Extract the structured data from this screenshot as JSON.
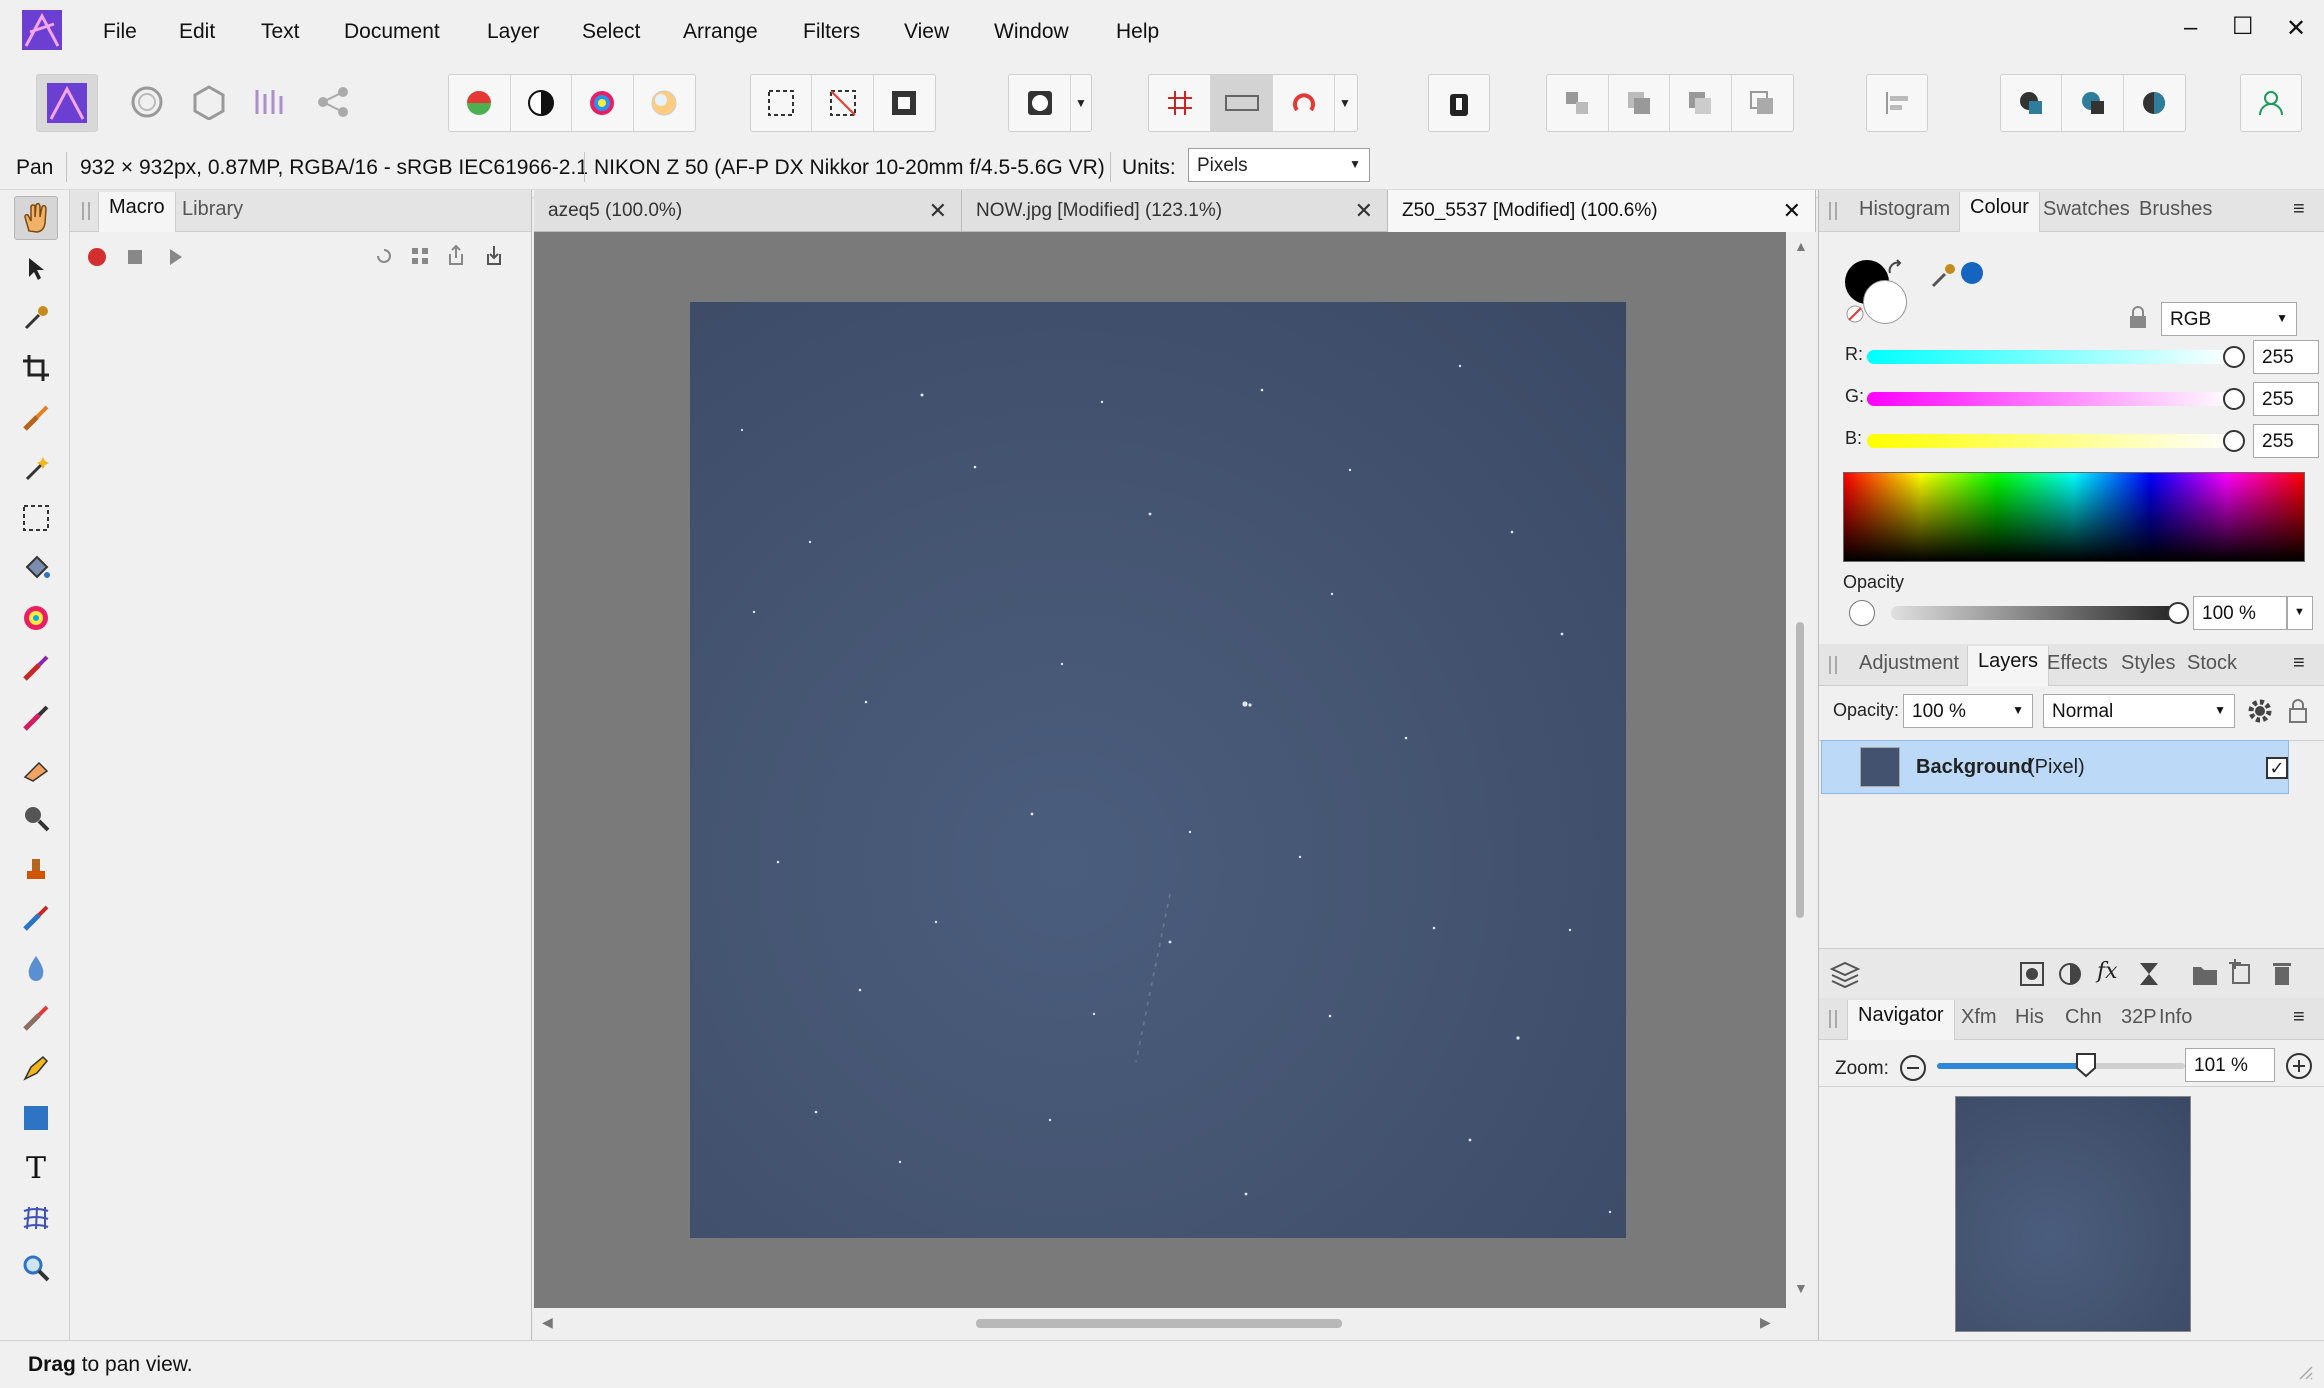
{
  "menu": [
    "File",
    "Edit",
    "Text",
    "Document",
    "Layer",
    "Select",
    "Arrange",
    "Filters",
    "View",
    "Window",
    "Help"
  ],
  "window_controls": {
    "minimize": "–",
    "maximize": "☐",
    "close": "✕"
  },
  "context": {
    "tool": "Pan",
    "doc_info": "932 × 932px, 0.87MP, RGBA/16 - sRGB IEC61966-2.1",
    "camera": "NIKON Z 50 (AF-P DX Nikkor 10-20mm f/4.5-5.6G VR)",
    "units_label": "Units:",
    "units_value": "Pixels"
  },
  "left_panel": {
    "tabs": [
      "Macro",
      "Library"
    ],
    "active": "Macro"
  },
  "documents": [
    {
      "title": "azeq5 (100.0%)",
      "active": false
    },
    {
      "title": "NOW.jpg [Modified] (123.1%)",
      "active": false
    },
    {
      "title": "Z50_5537 [Modified] (100.6%)",
      "active": true
    }
  ],
  "colour_panel": {
    "tabs": [
      "Histogram",
      "Colour",
      "Swatches",
      "Brushes"
    ],
    "active": "Colour",
    "model": "RGB",
    "r_label": "R:",
    "r": "255",
    "g_label": "G:",
    "g": "255",
    "b_label": "B:",
    "b": "255",
    "opacity_label": "Opacity",
    "opacity": "100 %"
  },
  "layers_panel": {
    "tabs": [
      "Adjustment",
      "Layers",
      "Effects",
      "Styles",
      "Stock"
    ],
    "active": "Layers",
    "opacity_label": "Opacity:",
    "opacity": "100 %",
    "blend": "Normal",
    "layer_name": "Background",
    "layer_type": "(Pixel)"
  },
  "navigator_panel": {
    "tabs": [
      "Navigator",
      "Xfm",
      "His",
      "Chn",
      "32P",
      "Info"
    ],
    "active": "Navigator",
    "zoom_label": "Zoom:",
    "zoom": "101 %",
    "zoom_fraction": 0.6
  },
  "status": {
    "bold": "Drag",
    "rest": " to pan view."
  }
}
